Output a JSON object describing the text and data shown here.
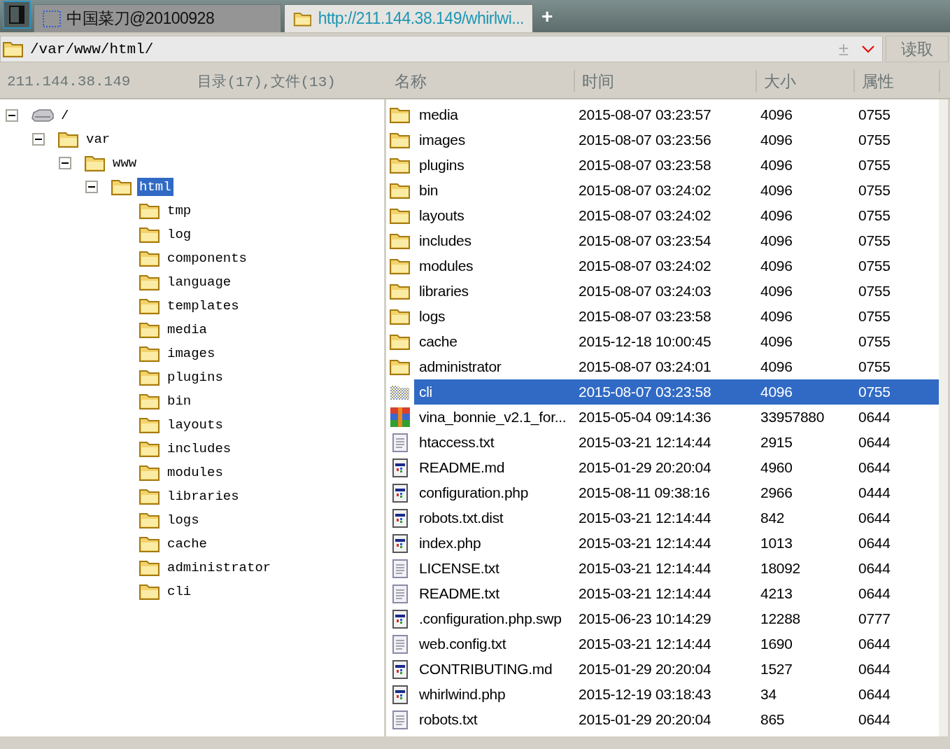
{
  "tabs": [
    {
      "label": "中国菜刀@20100928",
      "kind": "shell",
      "selected": false
    },
    {
      "label": "http://211.144.38.149/whirlwi...",
      "kind": "folder",
      "selected": true
    }
  ],
  "new_tab": "+",
  "path_bar": {
    "value": "/var/www/html/",
    "plus": "±",
    "button": "读取"
  },
  "left_header": {
    "host": "211.144.38.149",
    "summary": "目录(17),文件(13)"
  },
  "columns": [
    "名称",
    "时间",
    "大小",
    "属性"
  ],
  "tree": {
    "label": "/",
    "kind": "drive",
    "expanded": true,
    "selected": false,
    "children": [
      {
        "label": "var",
        "kind": "folder",
        "expanded": true,
        "selected": false,
        "children": [
          {
            "label": "www",
            "kind": "folder",
            "expanded": true,
            "selected": false,
            "children": [
              {
                "label": "html",
                "kind": "folder",
                "expanded": true,
                "selected": true,
                "children": [
                  {
                    "label": "tmp",
                    "kind": "folder",
                    "selected": false
                  },
                  {
                    "label": "log",
                    "kind": "folder",
                    "selected": false
                  },
                  {
                    "label": "components",
                    "kind": "folder",
                    "selected": false
                  },
                  {
                    "label": "language",
                    "kind": "folder",
                    "selected": false
                  },
                  {
                    "label": "templates",
                    "kind": "folder",
                    "selected": false
                  },
                  {
                    "label": "media",
                    "kind": "folder",
                    "selected": false
                  },
                  {
                    "label": "images",
                    "kind": "folder",
                    "selected": false
                  },
                  {
                    "label": "plugins",
                    "kind": "folder",
                    "selected": false
                  },
                  {
                    "label": "bin",
                    "kind": "folder",
                    "selected": false
                  },
                  {
                    "label": "layouts",
                    "kind": "folder",
                    "selected": false
                  },
                  {
                    "label": "includes",
                    "kind": "folder",
                    "selected": false
                  },
                  {
                    "label": "modules",
                    "kind": "folder",
                    "selected": false
                  },
                  {
                    "label": "libraries",
                    "kind": "folder",
                    "selected": false
                  },
                  {
                    "label": "logs",
                    "kind": "folder",
                    "selected": false
                  },
                  {
                    "label": "cache",
                    "kind": "folder",
                    "selected": false
                  },
                  {
                    "label": "administrator",
                    "kind": "folder",
                    "selected": false
                  },
                  {
                    "label": "cli",
                    "kind": "folder",
                    "selected": false
                  }
                ]
              }
            ]
          }
        ]
      }
    ]
  },
  "files": [
    {
      "kind": "folder",
      "name": "media",
      "time": "2015-08-07 03:23:57",
      "size": "4096",
      "mode": "0755",
      "selected": false
    },
    {
      "kind": "folder",
      "name": "images",
      "time": "2015-08-07 03:23:56",
      "size": "4096",
      "mode": "0755",
      "selected": false
    },
    {
      "kind": "folder",
      "name": "plugins",
      "time": "2015-08-07 03:23:58",
      "size": "4096",
      "mode": "0755",
      "selected": false
    },
    {
      "kind": "folder",
      "name": "bin",
      "time": "2015-08-07 03:24:02",
      "size": "4096",
      "mode": "0755",
      "selected": false
    },
    {
      "kind": "folder",
      "name": "layouts",
      "time": "2015-08-07 03:24:02",
      "size": "4096",
      "mode": "0755",
      "selected": false
    },
    {
      "kind": "folder",
      "name": "includes",
      "time": "2015-08-07 03:23:54",
      "size": "4096",
      "mode": "0755",
      "selected": false
    },
    {
      "kind": "folder",
      "name": "modules",
      "time": "2015-08-07 03:24:02",
      "size": "4096",
      "mode": "0755",
      "selected": false
    },
    {
      "kind": "folder",
      "name": "libraries",
      "time": "2015-08-07 03:24:03",
      "size": "4096",
      "mode": "0755",
      "selected": false
    },
    {
      "kind": "folder",
      "name": "logs",
      "time": "2015-08-07 03:23:58",
      "size": "4096",
      "mode": "0755",
      "selected": false
    },
    {
      "kind": "folder",
      "name": "cache",
      "time": "2015-12-18 10:00:45",
      "size": "4096",
      "mode": "0755",
      "selected": false
    },
    {
      "kind": "folder",
      "name": "administrator",
      "time": "2015-08-07 03:24:01",
      "size": "4096",
      "mode": "0755",
      "selected": false
    },
    {
      "kind": "folder",
      "name": "cli",
      "time": "2015-08-07 03:23:58",
      "size": "4096",
      "mode": "0755",
      "selected": true
    },
    {
      "kind": "archive",
      "name": "vina_bonnie_v2.1_for...",
      "time": "2015-05-04 09:14:36",
      "size": "33957880",
      "mode": "0644",
      "selected": false
    },
    {
      "kind": "text",
      "name": "htaccess.txt",
      "time": "2015-03-21 12:14:44",
      "size": "2915",
      "mode": "0644",
      "selected": false
    },
    {
      "kind": "app",
      "name": "README.md",
      "time": "2015-01-29 20:20:04",
      "size": "4960",
      "mode": "0644",
      "selected": false
    },
    {
      "kind": "app",
      "name": "configuration.php",
      "time": "2015-08-11 09:38:16",
      "size": "2966",
      "mode": "0444",
      "selected": false
    },
    {
      "kind": "app",
      "name": "robots.txt.dist",
      "time": "2015-03-21 12:14:44",
      "size": "842",
      "mode": "0644",
      "selected": false
    },
    {
      "kind": "app",
      "name": "index.php",
      "time": "2015-03-21 12:14:44",
      "size": "1013",
      "mode": "0644",
      "selected": false
    },
    {
      "kind": "text",
      "name": "LICENSE.txt",
      "time": "2015-03-21 12:14:44",
      "size": "18092",
      "mode": "0644",
      "selected": false
    },
    {
      "kind": "text",
      "name": "README.txt",
      "time": "2015-03-21 12:14:44",
      "size": "4213",
      "mode": "0644",
      "selected": false
    },
    {
      "kind": "app",
      "name": ".configuration.php.swp",
      "time": "2015-06-23 10:14:29",
      "size": "12288",
      "mode": "0777",
      "selected": false
    },
    {
      "kind": "text",
      "name": "web.config.txt",
      "time": "2015-03-21 12:14:44",
      "size": "1690",
      "mode": "0644",
      "selected": false
    },
    {
      "kind": "app",
      "name": "CONTRIBUTING.md",
      "time": "2015-01-29 20:20:04",
      "size": "1527",
      "mode": "0644",
      "selected": false
    },
    {
      "kind": "app",
      "name": "whirlwind.php",
      "time": "2015-12-19 03:18:43",
      "size": "34",
      "mode": "0644",
      "selected": false
    },
    {
      "kind": "text",
      "name": "robots.txt",
      "time": "2015-01-29 20:20:04",
      "size": "865",
      "mode": "0644",
      "selected": false
    }
  ]
}
